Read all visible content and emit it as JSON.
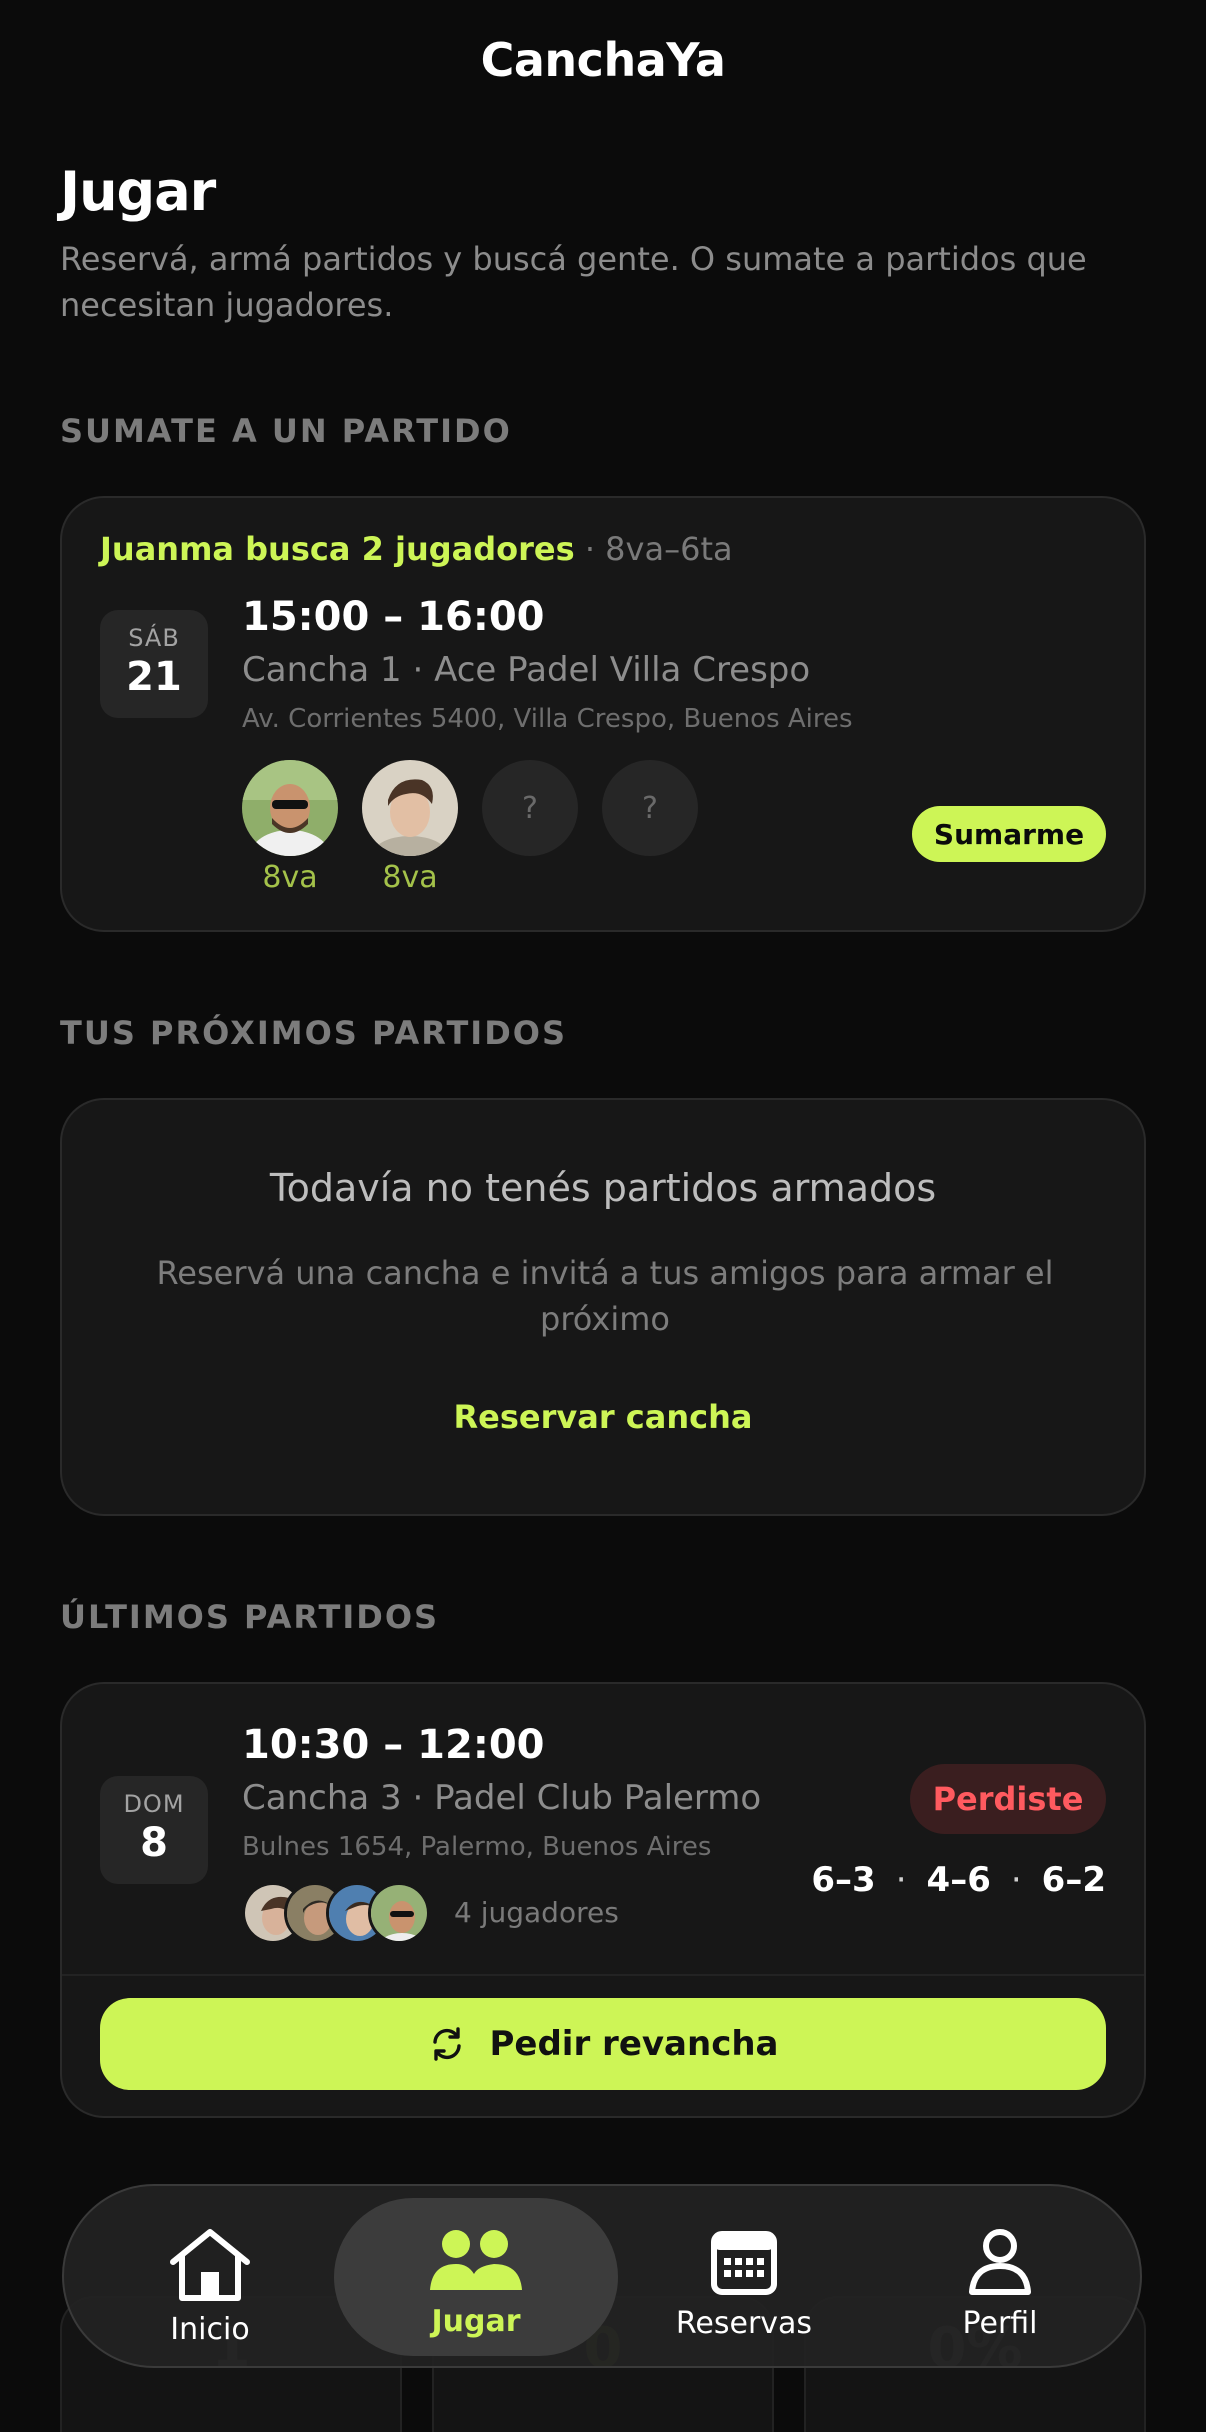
{
  "app": {
    "title": "CanchaYa"
  },
  "header": {
    "title": "Jugar",
    "subtitle": "Reservá, armá partidos y buscá gente. O sumate a partidos que necesitan jugadores."
  },
  "open_match_section": {
    "label": "SUMATE A UN PARTIDO",
    "card": {
      "organizer_text": "Juanma busca 2 jugadores",
      "separator": "·",
      "category": "8va–6ta",
      "day": "SÁB",
      "date": "21",
      "time": "15:00 – 16:00",
      "court": "Cancha 1 · Ace Padel Villa Crespo",
      "address": "Av. Corrientes 5400, Villa Crespo, Buenos Aires",
      "players": [
        {
          "avatar": "player-photo",
          "level": "8va"
        },
        {
          "avatar": "player-photo",
          "level": "8va"
        },
        {
          "avatar": "empty-slot",
          "placeholder": "?"
        },
        {
          "avatar": "empty-slot",
          "placeholder": "?"
        }
      ],
      "join_label": "Sumarme"
    }
  },
  "upcoming_section": {
    "label": "TUS PRÓXIMOS PARTIDOS",
    "empty_title": "Todavía no tenés partidos armados",
    "empty_desc": "Reservá una cancha e invitá a tus amigos para armar el próximo",
    "cta": "Reservar cancha"
  },
  "last_matches_section": {
    "label": "ÚLTIMOS PARTIDOS",
    "match": {
      "day": "DOM",
      "date": "8",
      "time": "10:30 – 12:00",
      "court": "Cancha 3 · Padel Club Palermo",
      "address": "Bulnes 1654, Palermo, Buenos Aires",
      "result": "Perdiste",
      "sets": [
        "6–3",
        "4–6",
        "6–2"
      ],
      "set_separator": "·",
      "players_count": "4 jugadores",
      "rematch_label": "Pedir revancha"
    }
  },
  "stats_section": {
    "values": [
      "1",
      "0",
      "0%"
    ]
  },
  "bottom_nav": {
    "items": [
      {
        "label": "Inicio",
        "icon": "home-icon"
      },
      {
        "label": "Jugar",
        "icon": "people-icon",
        "active": true
      },
      {
        "label": "Reservas",
        "icon": "calendar-icon"
      },
      {
        "label": "Perfil",
        "icon": "person-icon"
      }
    ]
  },
  "colors": {
    "background": "#0b0b0b",
    "card": "#171717",
    "accent": "#cdf556",
    "loss": "#ff5a5f",
    "muted_text": "#8c8c8c"
  }
}
